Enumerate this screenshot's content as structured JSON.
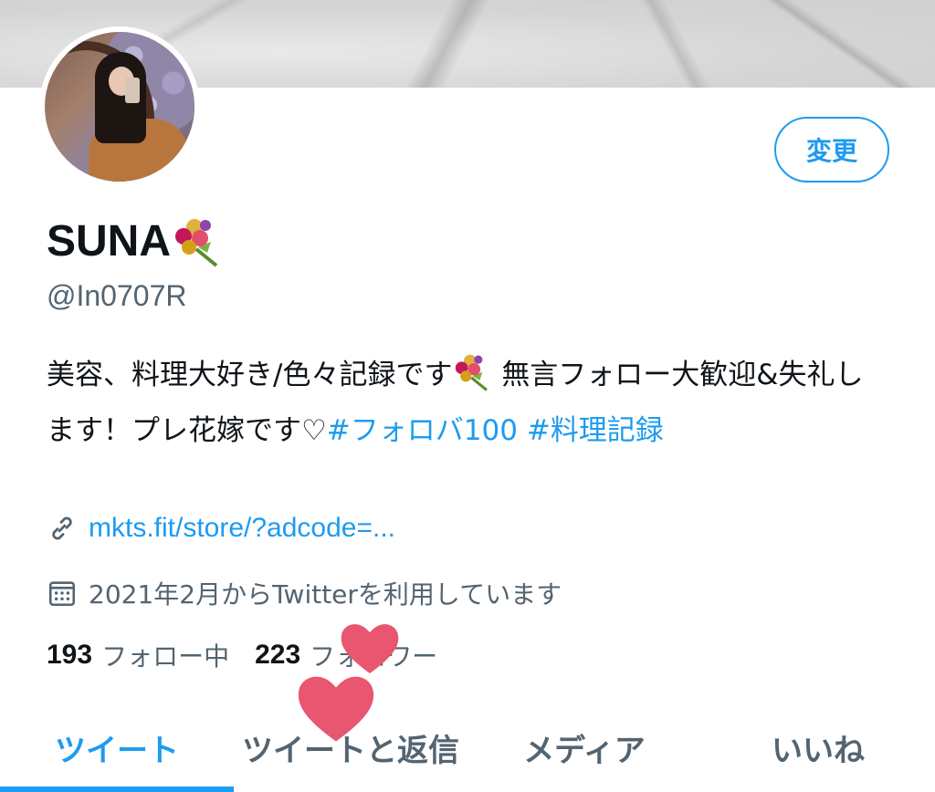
{
  "profile": {
    "display_name": "SUNA",
    "handle": "@In0707R",
    "edit_button": "変更",
    "bio": {
      "part1": "美容、料理大好き/色々記録です",
      "part2": "無言フォロー大歓迎&失礼します！プレ花嫁です♡",
      "hashtag1": "#フォロバ100",
      "hashtag2": "#料理記録"
    },
    "link": "mkts.fit/store/?adcode=...",
    "joined": "2021年2月からTwitterを利用しています",
    "following_count": "193",
    "following_label": "フォロー中",
    "followers_count": "223",
    "followers_label": "フォロワー"
  },
  "tabs": [
    {
      "label": "ツイート",
      "active": true
    },
    {
      "label": "ツイートと返信",
      "active": false
    },
    {
      "label": "メディア",
      "active": false
    },
    {
      "label": "いいね",
      "active": false
    }
  ],
  "icons": {
    "link": "link-icon",
    "calendar": "calendar-icon",
    "bouquet": "bouquet-emoji",
    "heart_sticker": "heart-sticker"
  },
  "colors": {
    "accent": "#1d9bf0",
    "secondary_text": "#536471",
    "primary_text": "#0f1419",
    "heart": "#e8566f"
  }
}
